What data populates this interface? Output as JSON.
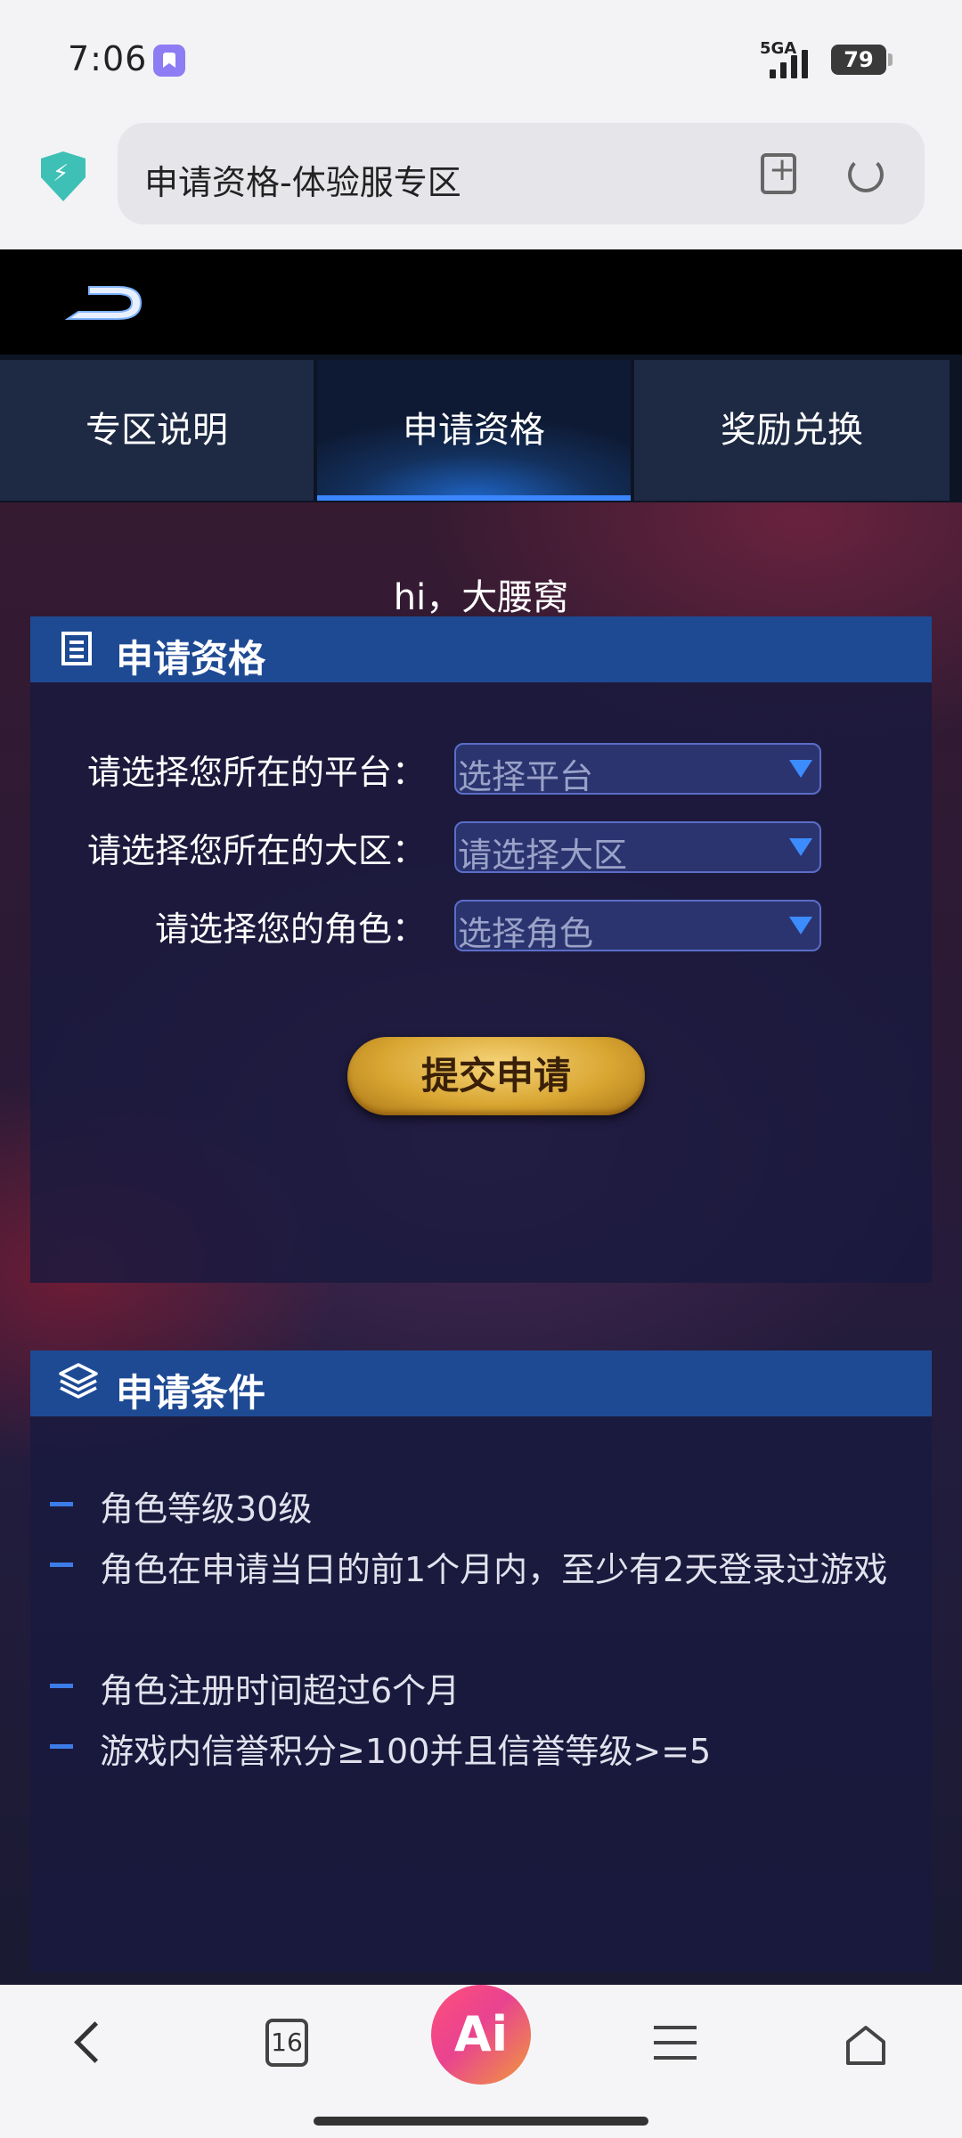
{
  "status_bar": {
    "time": "7:06",
    "network": "5GA",
    "battery": "79"
  },
  "browser": {
    "url_title": "申请资格-体验服专区"
  },
  "tabs": [
    {
      "label": "专区说明"
    },
    {
      "label": "申请资格"
    },
    {
      "label": "奖励兑换"
    }
  ],
  "greeting": "hi，大腰窝",
  "apply_panel": {
    "title": "申请资格",
    "fields": [
      {
        "label": "请选择您所在的平台：",
        "value": "选择平台"
      },
      {
        "label": "请选择您所在的大区：",
        "value": "请选择大区"
      },
      {
        "label": "请选择您的角色：",
        "value": "选择角色"
      }
    ],
    "submit_label": "提交申请"
  },
  "conditions_panel": {
    "title": "申请条件",
    "items": [
      "角色等级30级",
      "角色在申请当日的前1个月内，至少有2天登录过游戏",
      "角色注册时间超过6个月",
      "游戏内信誉积分≥100并且信誉等级>=5"
    ]
  },
  "bottom_nav": {
    "tab_count": "16",
    "ai_label": "Ai"
  },
  "colors": {
    "accent_blue": "#3c86ff",
    "panel_header": "#1e4a94",
    "gold_button": "#d9a632"
  }
}
